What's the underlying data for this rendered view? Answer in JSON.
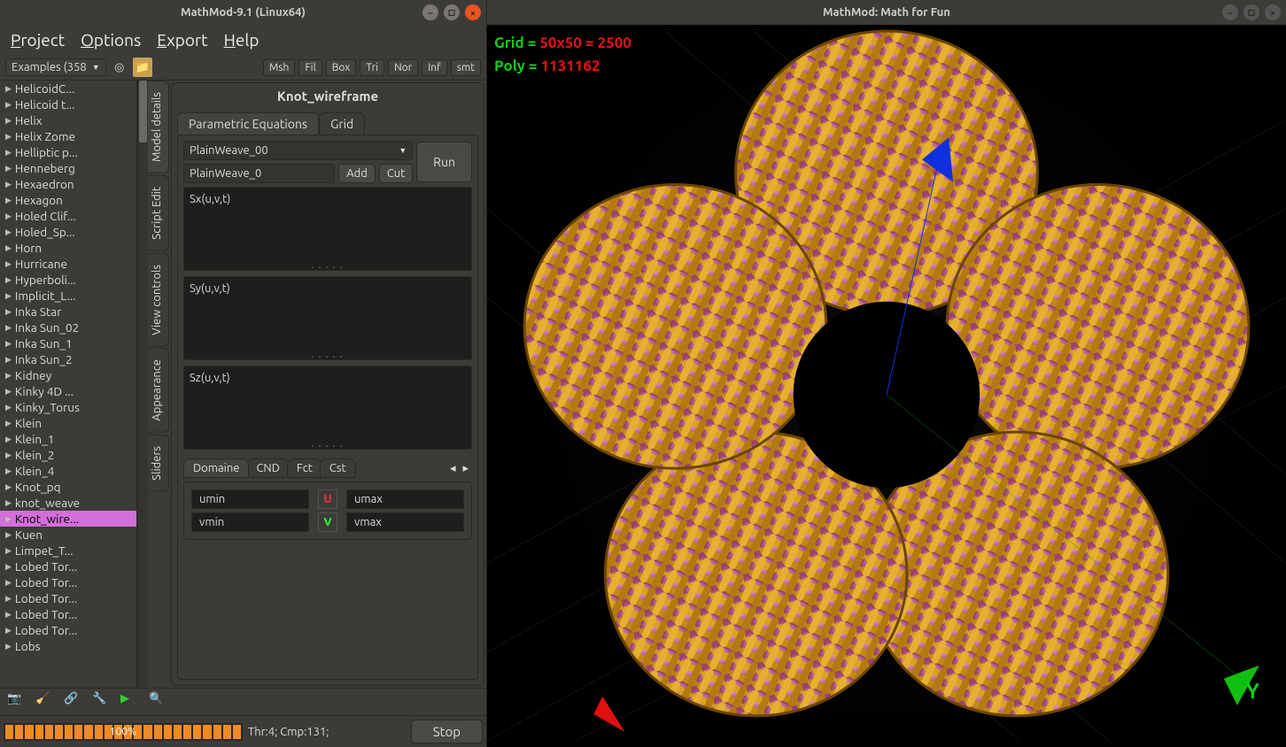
{
  "left_window": {
    "title": "MathMod-9.1  (Linux64)"
  },
  "right_window": {
    "title": "MathMod: Math for Fun"
  },
  "menu": {
    "project": "Project",
    "options": "Options",
    "export": "Export",
    "help": "Help"
  },
  "examples_dropdown": "Examples (358",
  "tool_buttons": {
    "msh": "Msh",
    "fil": "Fil",
    "box": "Box",
    "tri": "Tri",
    "nor": "Nor",
    "inf": "Inf",
    "smt": "smt"
  },
  "tree_items": [
    "HelicoidC...",
    "Helicoid t...",
    "Helix",
    "Helix Zome",
    "Helliptic p...",
    "Henneberg",
    "Hexaedron",
    "Hexagon",
    "Holed Clif...",
    "Holed_Sp...",
    "Horn",
    "Hurricane",
    "Hyperboli...",
    "Implicit_L...",
    "Inka Star",
    "Inka Sun_02",
    "Inka Sun_1",
    "Inka Sun_2",
    "Kidney",
    "Kinky 4D ...",
    "Kinky_Torus",
    "Klein",
    "Klein_1",
    "Klein_2",
    "Klein_4",
    "Knot_pq",
    "knot_weave",
    "Knot_wire...",
    "Kuen",
    "Limpet_T...",
    "Lobed Tor...",
    "Lobed Tor...",
    "Lobed Tor...",
    "Lobed Tor...",
    "Lobed Tor...",
    "Lobs"
  ],
  "tree_selected_index": 27,
  "vtabs": [
    "Model details",
    "Script Edit",
    "View controls",
    "Appearance",
    "Sliders"
  ],
  "vtab_active": 0,
  "model_title": "Knot_wireframe",
  "htabs": {
    "param": "Parametric Equations",
    "grid": "Grid"
  },
  "component_select": "PlainWeave_00",
  "component_input": "PlainWeave_0",
  "buttons": {
    "run": "Run",
    "add": "Add",
    "cut": "Cut",
    "stop": "Stop"
  },
  "eq": {
    "sx": "Sx(u,v,t)",
    "sy": "Sy(u,v,t)",
    "sz": "Sz(u,v,t)"
  },
  "domtabs": [
    "Domaine",
    "CND",
    "Fct",
    "Cst"
  ],
  "domain": {
    "umin": "umin",
    "umax": "umax",
    "vmin": "vmin",
    "vmax": "vmax",
    "u_label": "U",
    "v_label": "V"
  },
  "status": {
    "thr": "Thr:4; Cmp:131;",
    "pct": "100%"
  },
  "overlay": {
    "grid_label": "Grid = ",
    "grid_val": "50x50 = 2500",
    "poly_label": "Poly = ",
    "poly_val": "1131162",
    "y_axis": "Y"
  }
}
